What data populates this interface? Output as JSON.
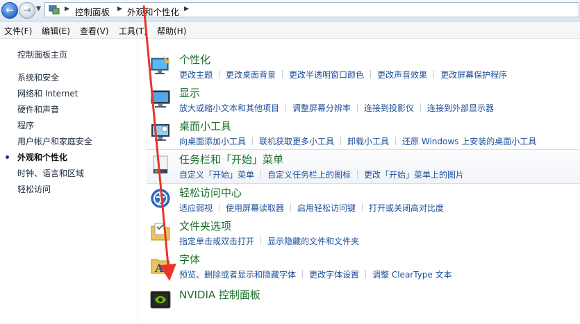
{
  "address": {
    "crumbs": [
      "控制面板",
      "外观和个性化"
    ]
  },
  "menu": [
    "文件(F)",
    "编辑(E)",
    "查看(V)",
    "工具(T)",
    "帮助(H)"
  ],
  "sidebar": {
    "home": "控制面板主页",
    "items": [
      {
        "label": "系统和安全"
      },
      {
        "label": "网络和 Internet"
      },
      {
        "label": "硬件和声音"
      },
      {
        "label": "程序"
      },
      {
        "label": "用户帐户和家庭安全"
      },
      {
        "label": "外观和个性化",
        "current": true
      },
      {
        "label": "时钟、语言和区域"
      },
      {
        "label": "轻松访问"
      }
    ]
  },
  "categories": [
    {
      "title": "个性化",
      "icon": "personalization-icon",
      "links": [
        "更改主题",
        "更改桌面背景",
        "更改半透明窗口颜色",
        "更改声音效果",
        "更改屏幕保护程序"
      ]
    },
    {
      "title": "显示",
      "icon": "display-icon",
      "links": [
        "放大或缩小文本和其他项目",
        "调整屏幕分辨率",
        "连接到投影仪",
        "连接到外部显示器"
      ]
    },
    {
      "title": "桌面小工具",
      "icon": "gadgets-icon",
      "links": [
        "向桌面添加小工具",
        "联机获取更多小工具",
        "卸载小工具",
        "还原 Windows 上安装的桌面小工具"
      ]
    },
    {
      "title": "任务栏和「开始」菜单",
      "icon": "taskbar-icon",
      "links": [
        "自定义「开始」菜单",
        "自定义任务栏上的图标",
        "更改「开始」菜单上的图片"
      ]
    },
    {
      "title": "轻松访问中心",
      "icon": "ease-of-access-icon",
      "links": [
        "适应弱视",
        "使用屏幕读取器",
        "启用轻松访问键",
        "打开或关闭高对比度"
      ]
    },
    {
      "title": "文件夹选项",
      "icon": "folder-options-icon",
      "links": [
        "指定单击或双击打开",
        "显示隐藏的文件和文件夹"
      ]
    },
    {
      "title": "字体",
      "icon": "fonts-icon",
      "links": [
        "预览、删除或者显示和隐藏字体",
        "更改字体设置",
        "调整 ClearType 文本"
      ]
    },
    {
      "title": "NVIDIA 控制面板",
      "icon": "nvidia-icon",
      "links": []
    }
  ],
  "colors": {
    "title_green": "#1a6e2a",
    "link_blue": "#1c4e9a",
    "annotation_red": "#e8352b"
  }
}
